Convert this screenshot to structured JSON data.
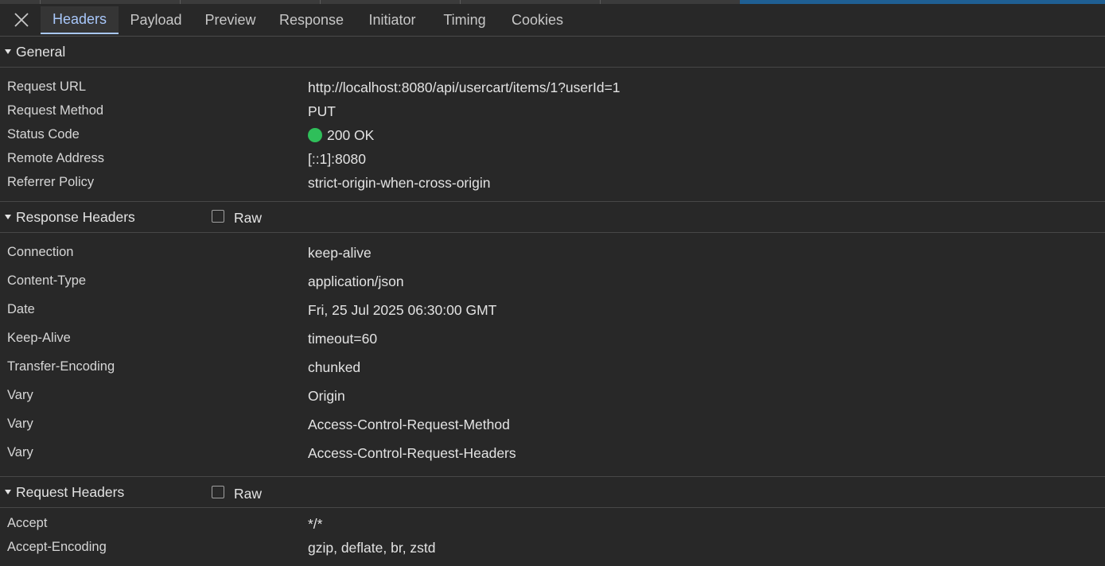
{
  "colors": {
    "accent": "#a8c7fa",
    "status_ok": "#2fbf5a"
  },
  "toolbar": {
    "close_icon": "close-icon",
    "tabs": [
      {
        "label": "Headers",
        "active": true
      },
      {
        "label": "Payload",
        "active": false
      },
      {
        "label": "Preview",
        "active": false
      },
      {
        "label": "Response",
        "active": false
      },
      {
        "label": "Initiator",
        "active": false
      },
      {
        "label": "Timing",
        "active": false
      },
      {
        "label": "Cookies",
        "active": false
      }
    ]
  },
  "general": {
    "title": "General",
    "rows": [
      {
        "key": "Request URL",
        "value": "http://localhost:8080/api/usercart/items/1?userId=1"
      },
      {
        "key": "Request Method",
        "value": "PUT"
      },
      {
        "key": "Status Code",
        "value": "200 OK"
      },
      {
        "key": "Remote Address",
        "value": "[::1]:8080"
      },
      {
        "key": "Referrer Policy",
        "value": "strict-origin-when-cross-origin"
      }
    ]
  },
  "response_headers": {
    "title": "Response Headers",
    "raw_label": "Raw",
    "rows": [
      {
        "key": "Connection",
        "value": "keep-alive"
      },
      {
        "key": "Content-Type",
        "value": "application/json"
      },
      {
        "key": "Date",
        "value": "Fri, 25 Jul 2025 06:30:00 GMT"
      },
      {
        "key": "Keep-Alive",
        "value": "timeout=60"
      },
      {
        "key": "Transfer-Encoding",
        "value": "chunked"
      },
      {
        "key": "Vary",
        "value": "Origin"
      },
      {
        "key": "Vary",
        "value": "Access-Control-Request-Method"
      },
      {
        "key": "Vary",
        "value": "Access-Control-Request-Headers"
      }
    ]
  },
  "request_headers": {
    "title": "Request Headers",
    "raw_label": "Raw",
    "rows": [
      {
        "key": "Accept",
        "value": "*/*"
      },
      {
        "key": "Accept-Encoding",
        "value": "gzip, deflate, br, zstd"
      }
    ]
  }
}
